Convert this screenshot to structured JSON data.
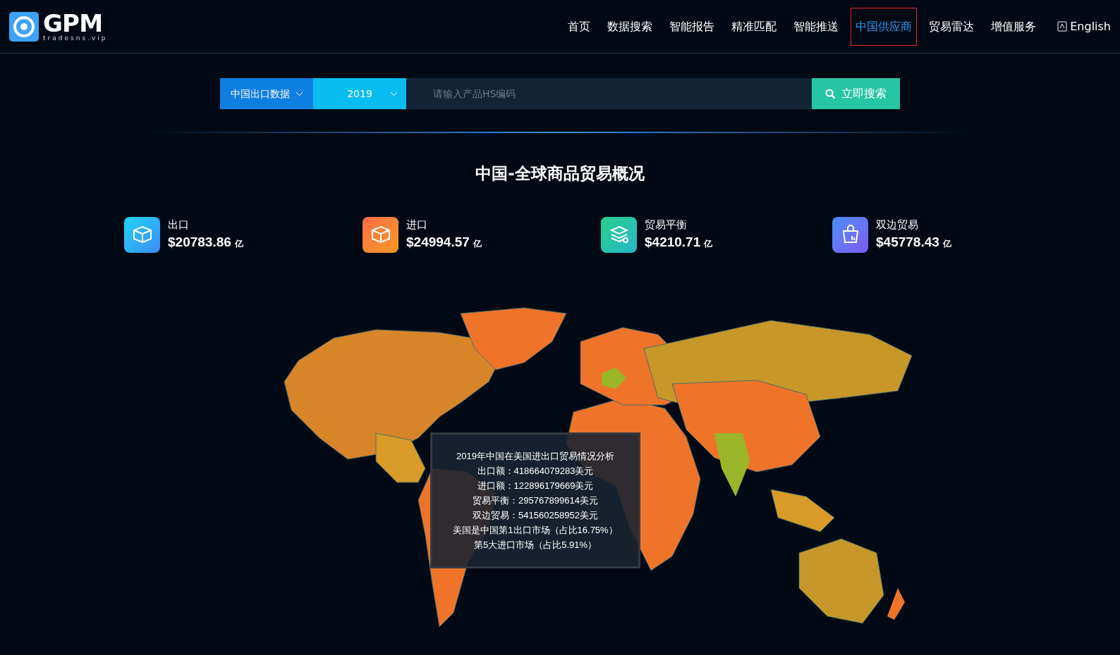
{
  "logo": {
    "name": "GPM",
    "domain": "tradesns.vip"
  },
  "nav": [
    {
      "label": "首页",
      "selected": false
    },
    {
      "label": "数据搜索",
      "selected": false
    },
    {
      "label": "智能报告",
      "selected": false
    },
    {
      "label": "精准匹配",
      "selected": false
    },
    {
      "label": "智能推送",
      "selected": false
    },
    {
      "label": "中国供应商",
      "selected": true
    },
    {
      "label": "贸易雷达",
      "selected": false
    },
    {
      "label": "增值服务",
      "selected": false
    }
  ],
  "language": "English",
  "search": {
    "dataset": "中国出口数据",
    "year": "2019",
    "placeholder": "请输入产品HS编码",
    "button": "立即搜索"
  },
  "title": "中国-全球商品贸易概况",
  "stats": [
    {
      "kind": "export",
      "label": "出口",
      "value": "$20783.86",
      "unit": "亿"
    },
    {
      "kind": "import",
      "label": "进口",
      "value": "$24994.57",
      "unit": "亿"
    },
    {
      "kind": "balance",
      "label": "贸易平衡",
      "value": "$4210.71",
      "unit": "亿"
    },
    {
      "kind": "bilateral",
      "label": "双边贸易",
      "value": "$45778.43",
      "unit": "亿"
    }
  ],
  "tooltip": {
    "lines": [
      "2019年中国在美国进出口贸易情况分析",
      "出口额：418664079283美元",
      "进口额：122896179669美元",
      "贸易平衡：295767899614美元",
      "双边贸易：541560258952美元",
      "美国是中国第1出口市场（占比16.75%）",
      "第5大进口市场（占比5.91%）"
    ]
  }
}
